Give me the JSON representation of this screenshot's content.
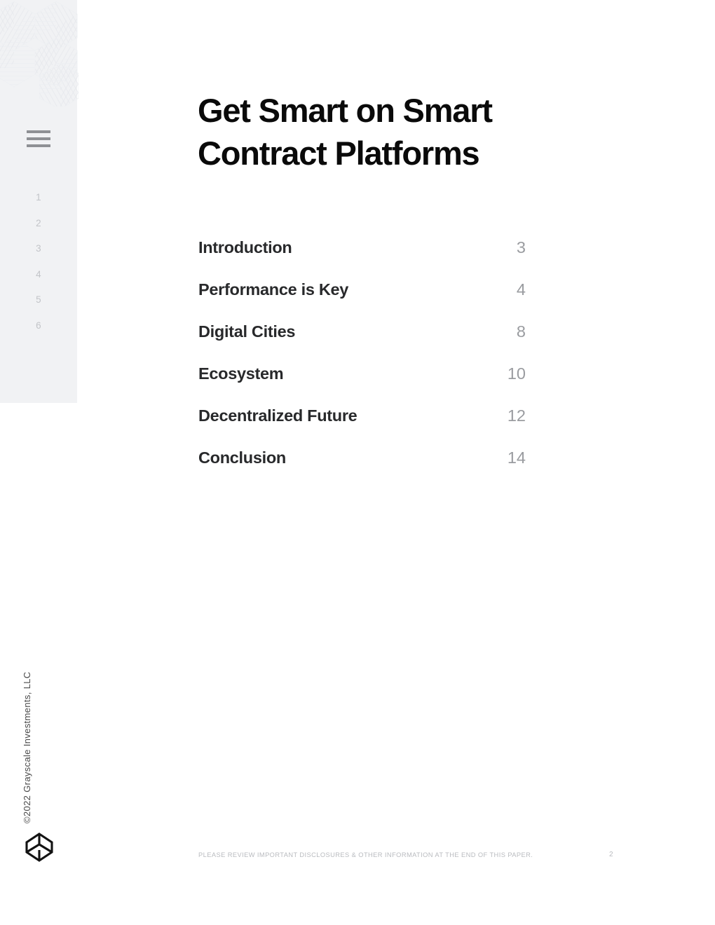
{
  "document": {
    "title_lines": [
      "Get Smart on Smart",
      "Contract Platforms"
    ],
    "copyright": "©2022 Grayscale Investments, LLC",
    "logo_name": "grayscale-logo"
  },
  "sidebar": {
    "menu_icon": "hamburger-menu-icon",
    "index_numbers": [
      "1",
      "2",
      "3",
      "4",
      "5",
      "6"
    ]
  },
  "toc": {
    "entries": [
      {
        "label": "Introduction",
        "page": "3"
      },
      {
        "label": "Performance is Key",
        "page": "4"
      },
      {
        "label": "Digital Cities",
        "page": "8"
      },
      {
        "label": "Ecosystem",
        "page": "10"
      },
      {
        "label": "Decentralized Future",
        "page": "12"
      },
      {
        "label": "Conclusion",
        "page": "14"
      }
    ]
  },
  "footer": {
    "disclosure": "PLEASE REVIEW IMPORTANT DISCLOSURES & OTHER INFORMATION AT THE END OF THIS PAPER.",
    "page_number": "2"
  },
  "colors": {
    "page_background": "#ffffff",
    "sidebar_background": "#f1f2f4",
    "title_text": "#0a0a0a",
    "toc_label_text": "#28292b",
    "toc_page_text": "#9a9ca0",
    "sidebar_index_text": "#c2c4c8",
    "menu_icon": "#8e9094",
    "footer_text": "#b9bbbf",
    "pattern_line": "#e9ebee"
  }
}
